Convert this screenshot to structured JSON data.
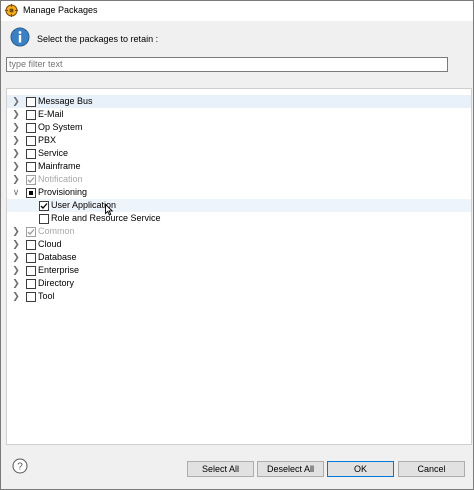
{
  "window": {
    "title": "Manage Packages"
  },
  "header": {
    "instruction": "Select the packages to retain :"
  },
  "filter": {
    "value": "",
    "placeholder": "type filter text"
  },
  "tree": {
    "items": [
      {
        "label": "Message Bus",
        "checked": false,
        "expanded": false,
        "disabled": false,
        "selected": true
      },
      {
        "label": "E-Mail",
        "checked": false,
        "expanded": false,
        "disabled": false
      },
      {
        "label": "Op System",
        "checked": false,
        "expanded": false,
        "disabled": false
      },
      {
        "label": "PBX",
        "checked": false,
        "expanded": false,
        "disabled": false
      },
      {
        "label": "Service",
        "checked": false,
        "expanded": false,
        "disabled": false
      },
      {
        "label": "Mainframe",
        "checked": false,
        "expanded": false,
        "disabled": false
      },
      {
        "label": "Notification",
        "checked": true,
        "expanded": false,
        "disabled": true
      },
      {
        "label": "Provisioning",
        "checked": "partial",
        "expanded": true,
        "disabled": false,
        "children": [
          {
            "label": "User Application",
            "checked": true,
            "disabled": false,
            "hover": true
          },
          {
            "label": "Role and Resource Service",
            "checked": false,
            "disabled": false
          }
        ]
      },
      {
        "label": "Common",
        "checked": true,
        "expanded": false,
        "disabled": true
      },
      {
        "label": "Cloud",
        "checked": false,
        "expanded": false,
        "disabled": false
      },
      {
        "label": "Database",
        "checked": false,
        "expanded": false,
        "disabled": false
      },
      {
        "label": "Enterprise",
        "checked": false,
        "expanded": false,
        "disabled": false
      },
      {
        "label": "Directory",
        "checked": false,
        "expanded": false,
        "disabled": false
      },
      {
        "label": "Tool",
        "checked": false,
        "expanded": false,
        "disabled": false
      }
    ]
  },
  "buttons": {
    "select_all": "Select All",
    "deselect_all": "Deselect All",
    "ok": "OK",
    "cancel": "Cancel"
  },
  "colors": {
    "selection": "#e8f0fa",
    "info_icon": "#3b7fc4",
    "default_button_border": "#0078d7"
  }
}
